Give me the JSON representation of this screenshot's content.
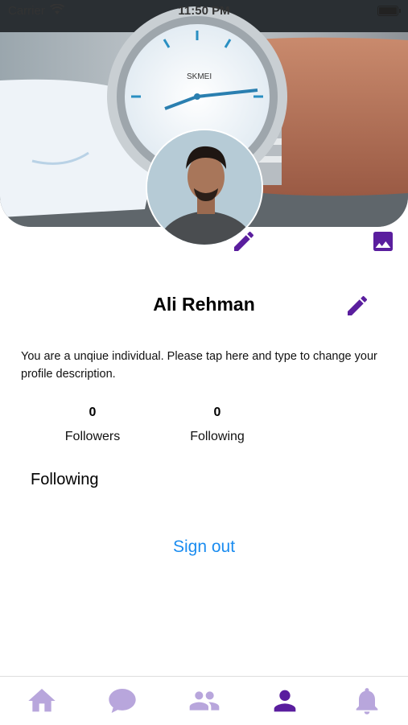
{
  "status_bar": {
    "carrier": "Carrier",
    "time": "11:50 PM"
  },
  "profile": {
    "name": "Ali Rehman",
    "description": "You are a unqiue individual. Please tap here and type to change your profile description."
  },
  "stats": {
    "followers": {
      "count": "0",
      "label": "Followers"
    },
    "following": {
      "count": "0",
      "label": "Following"
    }
  },
  "section_title": "Following",
  "sign_out_label": "Sign out",
  "cover_watch_brand": "SKMEI",
  "colors": {
    "accent": "#5a1e9e",
    "link": "#1a8cf0",
    "tab_inactive": "#b8a6dc"
  },
  "tabs": [
    {
      "name": "home",
      "icon": "home-icon",
      "active": false
    },
    {
      "name": "chat",
      "icon": "chat-bubble-icon",
      "active": false
    },
    {
      "name": "friends",
      "icon": "people-icon",
      "active": false
    },
    {
      "name": "profile",
      "icon": "person-icon",
      "active": true
    },
    {
      "name": "notifications",
      "icon": "bell-icon",
      "active": false
    }
  ]
}
